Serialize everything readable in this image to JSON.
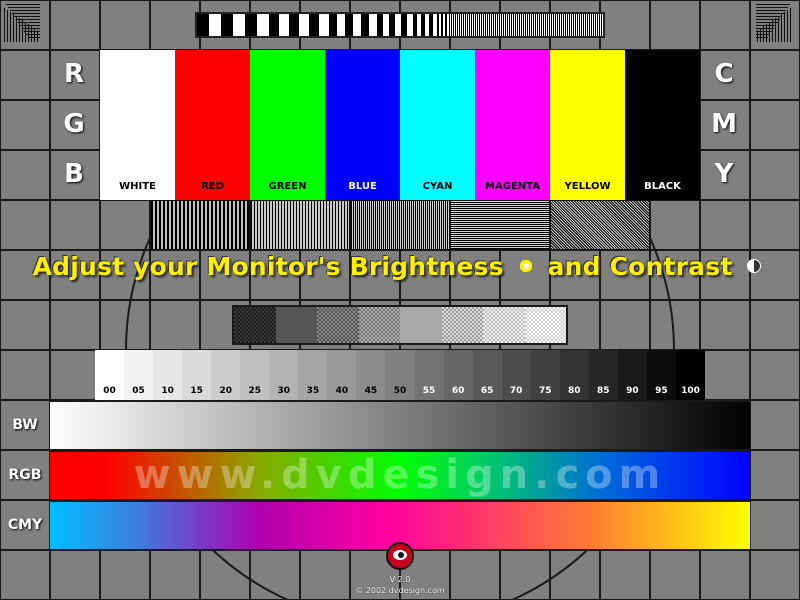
{
  "left_letters": [
    "R",
    "G",
    "B"
  ],
  "right_letters": [
    "C",
    "M",
    "Y"
  ],
  "color_bars": [
    {
      "label": "WHITE",
      "color": "#ffffff",
      "text_color": "#000000"
    },
    {
      "label": "RED",
      "color": "#ff0000",
      "text_color": "#000000"
    },
    {
      "label": "GREEN",
      "color": "#00ff00",
      "text_color": "#000000"
    },
    {
      "label": "BLUE",
      "color": "#0000ff",
      "text_color": "#ffffff"
    },
    {
      "label": "CYAN",
      "color": "#00ffff",
      "text_color": "#000000"
    },
    {
      "label": "MAGENTA",
      "color": "#ff00ff",
      "text_color": "#000000"
    },
    {
      "label": "YELLOW",
      "color": "#ffff00",
      "text_color": "#000000"
    },
    {
      "label": "BLACK",
      "color": "#000000",
      "text_color": "#ffffff"
    }
  ],
  "headline": {
    "part1": "Adjust your Monitor's Brightness",
    "part2": "and Contrast",
    "color": "#ffee00"
  },
  "gray_scale": {
    "labels": [
      "00",
      "05",
      "10",
      "15",
      "20",
      "25",
      "30",
      "35",
      "40",
      "45",
      "50",
      "55",
      "60",
      "65",
      "70",
      "75",
      "80",
      "85",
      "90",
      "95",
      "100"
    ]
  },
  "gradient_rows": [
    {
      "label": "BW"
    },
    {
      "label": "RGB"
    },
    {
      "label": "CMY"
    }
  ],
  "watermark": "www.dvdesign.com",
  "footer": {
    "version": "V 2.0",
    "copyright": "© 2002 dvdesign.com"
  },
  "icons": [
    "sun-icon",
    "half-moon-contrast-icon",
    "eye-logo-icon"
  ],
  "background_color": "#808080",
  "grid_line_color": "#1a1a1a"
}
